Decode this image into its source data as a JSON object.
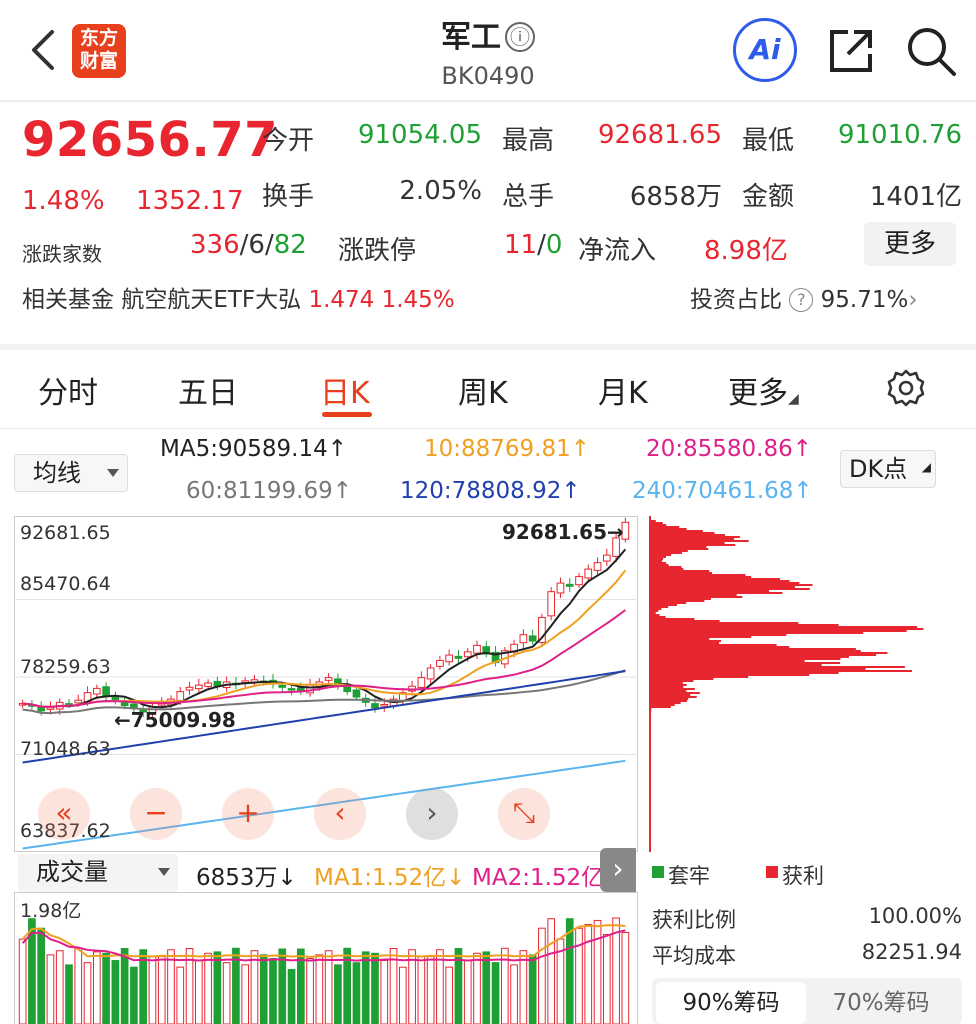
{
  "header": {
    "logo_line1": "东方",
    "logo_line2": "财富",
    "title": "军工",
    "info_icon": "ⓘ",
    "code": "BK0490",
    "ai_label": "Ai"
  },
  "quote": {
    "price": "92656.77",
    "change_pct": "1.48%",
    "change_amt": "1352.17",
    "open_label": "今开",
    "open_value": "91054.05",
    "high_label": "最高",
    "high_value": "92681.65",
    "low_label": "最低",
    "low_value": "91010.76",
    "turnover_label": "换手",
    "turnover_value": "2.05%",
    "volume_label": "总手",
    "volume_value": "6858万",
    "amount_label": "金额",
    "amount_value": "1401亿",
    "breadth_label": "涨跌家数",
    "breadth_up": "336",
    "breadth_slash1": "/",
    "breadth_flat": "6",
    "breadth_slash2": "/",
    "breadth_down": "82",
    "limit_label": "涨跌停",
    "limit_up": "11",
    "limit_slash": "/",
    "limit_down": "0",
    "netflow_label": "净流入",
    "netflow_value": "8.98亿",
    "more_label": "更多"
  },
  "fund": {
    "label": "相关基金",
    "name": "航空航天ETF大弘",
    "price": "1.474",
    "pct": "1.45%",
    "ratio_label": "投资占比",
    "ratio_help": "?",
    "ratio_value": "95.71%",
    "chevron": "›"
  },
  "tabs": [
    {
      "label": "分时"
    },
    {
      "label": "五日"
    },
    {
      "label": "日K"
    },
    {
      "label": "周K"
    },
    {
      "label": "月K"
    },
    {
      "label": "更多"
    }
  ],
  "ma": {
    "dropdown": "均线",
    "ma5": "MA5:90589.14↑",
    "ma10": "10:88769.81↑",
    "ma20": "20:85580.86↑",
    "ma60": "60:81199.69↑",
    "ma120": "120:78808.92↑",
    "ma240": "240:70461.68↑",
    "dk_button": "DK点",
    "colors": {
      "ma5": "#222222",
      "ma10": "#f0a020",
      "ma20": "#e0208a",
      "ma60": "#777777",
      "ma120": "#2040b0",
      "ma240": "#5ab4f0"
    }
  },
  "chart": {
    "y_labels": [
      "92681.65",
      "85470.64",
      "78259.63",
      "71048.63",
      "63837.62"
    ],
    "high_marker": "92681.65",
    "low_marker": "75009.98",
    "controls": [
      "«",
      "−",
      "+",
      "‹",
      "›",
      "⤡"
    ]
  },
  "chart_data": {
    "type": "candlestick",
    "ylim": [
      63837.62,
      92681.65
    ],
    "close": [
      75800,
      75600,
      75100,
      75400,
      75900,
      75700,
      76100,
      76800,
      77200,
      76500,
      76000,
      75600,
      75300,
      75009.98,
      75500,
      75800,
      76200,
      76900,
      77300,
      77500,
      77700,
      77400,
      77800,
      77600,
      77900,
      78000,
      77800,
      77600,
      77300,
      77100,
      76900,
      77500,
      77800,
      78200,
      77600,
      76900,
      76400,
      75900,
      75400,
      75700,
      76200,
      76800,
      77400,
      78200,
      79100,
      79800,
      80300,
      80000,
      80600,
      81200,
      80400,
      79600,
      80700,
      81300,
      82200,
      81600,
      83800,
      86200,
      87000,
      86700,
      87600,
      88300,
      88900,
      89600,
      91200,
      92656.77
    ]
  },
  "volume": {
    "dropdown": "成交量",
    "current": "6853万↓",
    "ma1": "MA1:1.52亿↓",
    "ma2": "MA2:1.52亿",
    "y_label": "1.98亿"
  },
  "chips": {
    "trapped_label": "套牢",
    "profit_label": "获利",
    "profit_ratio_label": "获利比例",
    "profit_ratio_value": "100.00%",
    "avg_cost_label": "平均成本",
    "avg_cost_value": "82251.94",
    "tab_90": "90%筹码",
    "tab_70": "70%筹码"
  }
}
